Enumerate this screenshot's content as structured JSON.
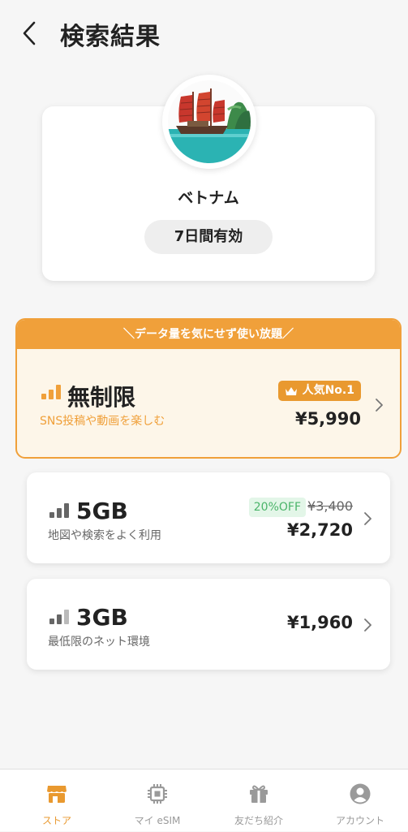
{
  "header": {
    "title": "検索結果"
  },
  "country": {
    "name": "ベトナム",
    "validity": "7日間有効"
  },
  "plans": {
    "featured": {
      "banner": "＼データ量を気にせず使い放題／",
      "name": "無制限",
      "description": "SNS投稿や動画を楽しむ",
      "badge": "人気No.1",
      "price": "¥5,990"
    },
    "items": [
      {
        "name": "5GB",
        "description": "地図や検索をよく利用",
        "discount": "20%OFF",
        "old_price": "¥3,400",
        "price": "¥2,720"
      },
      {
        "name": "3GB",
        "description": "最低限のネット環境",
        "price": "¥1,960"
      }
    ]
  },
  "tabbar": {
    "tabs": [
      {
        "label": "ストア",
        "icon": "store-icon",
        "active": true
      },
      {
        "label": "マイ eSIM",
        "icon": "chip-icon",
        "active": false
      },
      {
        "label": "友だち紹介",
        "icon": "gift-icon",
        "active": false
      },
      {
        "label": "アカウント",
        "icon": "account-icon",
        "active": false
      }
    ]
  },
  "colors": {
    "accent": "#f0a03a",
    "accent_bg": "#fdf6e9",
    "discount_text": "#4bb46a",
    "discount_bg": "#e3f6e8",
    "inactive": "#9a9a9a"
  }
}
